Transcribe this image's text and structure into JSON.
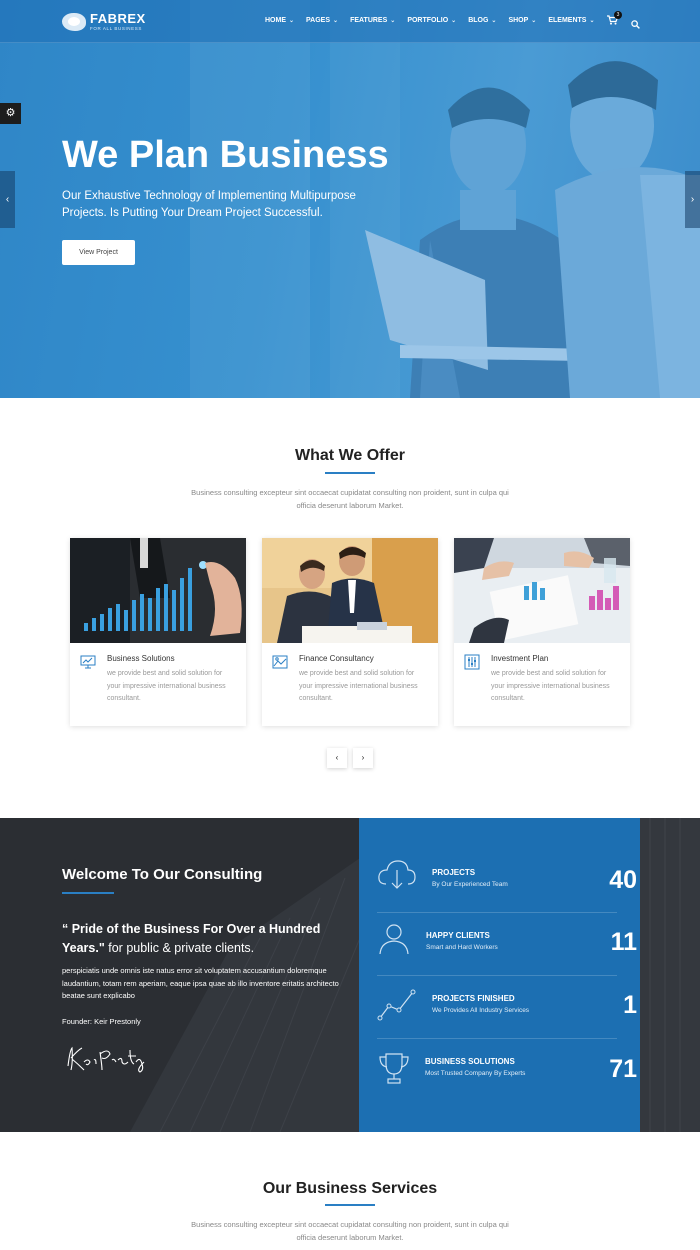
{
  "nav": {
    "brand": "FABREX",
    "tagline": "FOR ALL BUSINESS",
    "items": [
      {
        "label": "HOME"
      },
      {
        "label": "PAGES"
      },
      {
        "label": "FEATURES"
      },
      {
        "label": "PORTFOLIO"
      },
      {
        "label": "BLOG"
      },
      {
        "label": "SHOP"
      },
      {
        "label": "ELEMENTS"
      }
    ],
    "cart_count": "3",
    "icons": {
      "cart": "cart-icon",
      "search": "search-icon",
      "settings": "gear-icon"
    }
  },
  "hero": {
    "title": "We Plan Business",
    "subtitle": "Our Exhaustive Technology of Implementing Multipurpose Projects. Is Putting Your Dream Project Successful.",
    "button": "View Project"
  },
  "offer": {
    "title": "What We Offer",
    "description": "Business consulting excepteur sint occaecat cupidatat consulting non proident, sunt in culpa qui officia deserunt laborum Market.",
    "cards": [
      {
        "title": "Business Solutions",
        "text": "we provide best and solid solution for your impressive international business consultant.",
        "icon": "presentation-chart-icon"
      },
      {
        "title": "Finance Consultancy",
        "text": "we provide best and solid solution for your impressive international business consultant.",
        "icon": "image-chart-icon"
      },
      {
        "title": "Investment Plan",
        "text": "we provide best and solid solution for your impressive international business consultant.",
        "icon": "sliders-icon"
      }
    ]
  },
  "consulting": {
    "title": "Welcome To Our Consulting",
    "quote_bold": "“ Pride of the Business For Over a Hundred Years.\"",
    "quote_rest": " for public & private clients.",
    "body": "perspiciatis unde omnis iste natus error sit voluptatem accusantium doloremque laudantium, totam rem aperiam, eaque ipsa quae ab illo inventore eritatis architecto beatae sunt explicabo",
    "founder": "Founder: Keir Prestonly",
    "signature": "Keir Prestonly"
  },
  "stats": [
    {
      "title": "PROJECTS",
      "sub": "By Our Experienced Team",
      "value": "40",
      "icon": "cloud-download-icon"
    },
    {
      "title": "HAPPY CLIENTS",
      "sub": "Smart and Hard Workers",
      "value": "11",
      "icon": "user-icon"
    },
    {
      "title": "PROJECTS FINISHED",
      "sub": "We Provides All Industry Services",
      "value": "1",
      "icon": "line-graph-icon"
    },
    {
      "title": "BUSINESS SOLUTIONS",
      "sub": "Most Trusted Company By Experts",
      "value": "71",
      "icon": "trophy-icon"
    }
  ],
  "services": {
    "title": "Our Business Services",
    "description": "Business consulting excepteur sint occaecat cupidatat consulting non proident, sunt in culpa qui officia deserunt laborum Market."
  },
  "colors": {
    "brand_blue": "#2a7fc4",
    "stats_bg": "#1c6fb2",
    "dark_bg": "#2b2e33"
  }
}
